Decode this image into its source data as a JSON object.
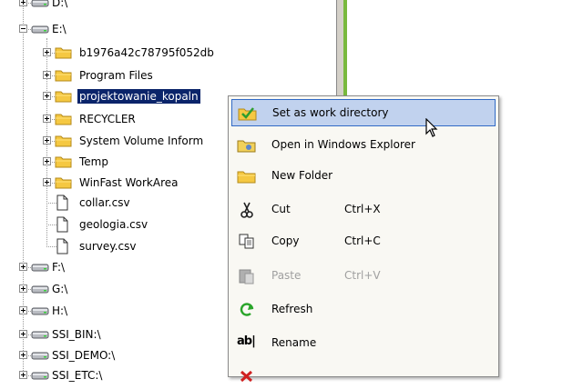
{
  "tree": {
    "items": [
      {
        "label": "D:\\",
        "kind": "drive",
        "level": 0,
        "expander": "plus"
      },
      {
        "label": "E:\\",
        "kind": "drive",
        "level": 0,
        "expander": "minus"
      },
      {
        "label": "b1976a42c78795f052db",
        "kind": "folder",
        "level": 1,
        "expander": "plus"
      },
      {
        "label": "Program Files",
        "kind": "folder",
        "level": 1,
        "expander": "plus"
      },
      {
        "label": "projektowanie_kopaln",
        "kind": "folder",
        "level": 1,
        "expander": "plus",
        "selected": true
      },
      {
        "label": "RECYCLER",
        "kind": "folder",
        "level": 1,
        "expander": "plus"
      },
      {
        "label": "System Volume Inform",
        "kind": "folder",
        "level": 1,
        "expander": "plus"
      },
      {
        "label": "Temp",
        "kind": "folder",
        "level": 1,
        "expander": "plus"
      },
      {
        "label": "WinFast WorkArea",
        "kind": "folder",
        "level": 1,
        "expander": "plus"
      },
      {
        "label": "collar.csv",
        "kind": "file",
        "level": 1
      },
      {
        "label": "geologia.csv",
        "kind": "file",
        "level": 1
      },
      {
        "label": "survey.csv",
        "kind": "file",
        "level": 1
      },
      {
        "label": "F:\\",
        "kind": "drive",
        "level": 0,
        "expander": "plus"
      },
      {
        "label": "G:\\",
        "kind": "drive",
        "level": 0,
        "expander": "plus"
      },
      {
        "label": "H:\\",
        "kind": "drive",
        "level": 0,
        "expander": "plus"
      },
      {
        "label": "SSI_BIN:\\",
        "kind": "drive",
        "level": 0,
        "expander": "plus"
      },
      {
        "label": "SSI_DEMO:\\",
        "kind": "drive",
        "level": 0,
        "expander": "plus"
      },
      {
        "label": "SSI_ETC:\\",
        "kind": "drive",
        "level": 0,
        "expander": "plus"
      }
    ]
  },
  "context_menu": {
    "items": [
      {
        "label": "Set as work directory",
        "icon": "check-folder-icon",
        "shortcut": "",
        "highlighted": true,
        "disabled": false
      },
      {
        "label": "Open in Windows Explorer",
        "icon": "explorer-folder-icon",
        "shortcut": "",
        "highlighted": false,
        "disabled": false
      },
      {
        "label": "New Folder",
        "icon": "new-folder-icon",
        "shortcut": "",
        "highlighted": false,
        "disabled": false
      },
      {
        "label": "Cut",
        "icon": "scissors-icon",
        "shortcut": "Ctrl+X",
        "highlighted": false,
        "disabled": false
      },
      {
        "label": "Copy",
        "icon": "copy-icon",
        "shortcut": "Ctrl+C",
        "highlighted": false,
        "disabled": false
      },
      {
        "label": "Paste",
        "icon": "paste-icon",
        "shortcut": "Ctrl+V",
        "highlighted": false,
        "disabled": true
      },
      {
        "label": "Refresh",
        "icon": "refresh-icon",
        "shortcut": "",
        "highlighted": false,
        "disabled": false
      },
      {
        "label": "Rename",
        "icon": "rename-icon",
        "shortcut": "",
        "highlighted": false,
        "disabled": false
      },
      {
        "label": "",
        "icon": "delete-icon",
        "shortcut": "",
        "highlighted": false,
        "disabled": false
      }
    ]
  },
  "colors": {
    "selection": "#0a246a",
    "menu_highlight": "#c1d2ee",
    "menu_highlight_border": "#316ac5",
    "splitter_green": "#79b93d",
    "folder": "#f5c842"
  }
}
